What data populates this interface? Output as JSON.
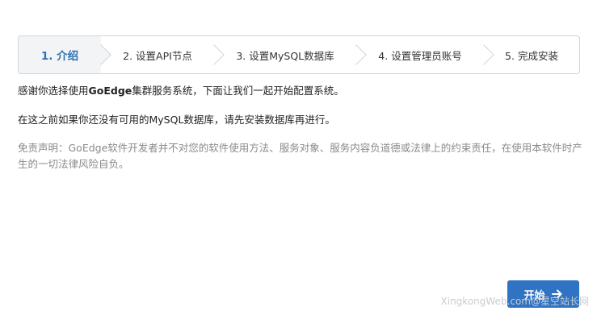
{
  "steps": [
    {
      "label": "1. 介绍",
      "active": true
    },
    {
      "label": "2. 设置API节点",
      "active": false
    },
    {
      "label": "3. 设置MySQL数据库",
      "active": false
    },
    {
      "label": "4. 设置管理员账号",
      "active": false
    },
    {
      "label": "5. 完成安装",
      "active": false
    }
  ],
  "intro": {
    "line1_pre": "感谢你选择使用",
    "line1_brand": "GoEdge",
    "line1_post": "集群服务系统，下面让我们一起开始配置系统。",
    "line2": "在这之前如果你还没有可用的MySQL数据库，请先安装数据库再进行。",
    "disclaimer": "免责声明：GoEdge软件开发者并不对您的软件使用方法、服务对象、服务内容负道德或法律上的约束责任，在使用本软件时产生的一切法律风险自负。"
  },
  "actions": {
    "start_label": "开始"
  },
  "watermark": "XingkongWeb.com@星空站长网",
  "colors": {
    "accent": "#2f73c2",
    "active_step_text": "#2f73b5",
    "border": "#d4d4d5"
  },
  "icons": {
    "start_button": "arrow-right-icon"
  }
}
